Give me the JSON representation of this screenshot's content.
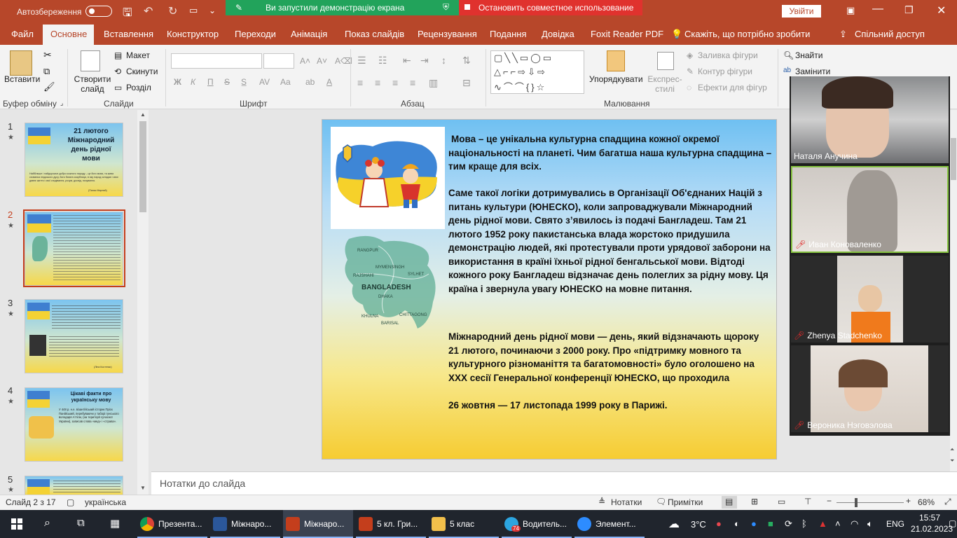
{
  "titlebar": {
    "autosave_label": "Автозбереження",
    "autosave_state": "off",
    "sharing_text": "Ви запустили демонстрацію екрана",
    "stop_sharing": "Остановить совместное использование",
    "signin": "Увійти",
    "accent": "#b7472a"
  },
  "tabs": [
    "Файл",
    "Основне",
    "Вставлення",
    "Конструктор",
    "Переходи",
    "Анімація",
    "Показ слайдів",
    "Рецензування",
    "Подання",
    "Довідка",
    "Foxit Reader PDF",
    "Скажіть, що потрібно зробити",
    "Спільний доступ"
  ],
  "ribbon": {
    "clipboard": {
      "paste": "Вставити",
      "label": "Буфер обміну"
    },
    "slides": {
      "new_slide": "Створити слайд",
      "layout": "Макет",
      "reset": "Скинути",
      "section": "Розділ",
      "label": "Слайди"
    },
    "font": {
      "label": "Шрифт",
      "bold": "Ж",
      "italic": "К",
      "underline": "П",
      "strike": "S"
    },
    "paragraph": {
      "label": "Абзац"
    },
    "drawing": {
      "label": "Малювання",
      "arrange": "Упорядкувати",
      "styles": "Експрес-стилі",
      "fill": "Заливка фігури",
      "outline": "Контур фігури",
      "effects": "Ефекти для фігур"
    },
    "editing": {
      "find": "Знайти",
      "replace": "Замінити"
    }
  },
  "thumbnails": [
    {
      "num": "1",
      "title": "21 лютого Міжнародний день рідної мови",
      "caption": "Найбільше і найдорожче добро кожного народу – це його мова, та жива схованка людського духу, його багата скарбниця, в яку народ складає і своє давнє життя і свої сподівання, розум, досвід, почування.",
      "author": "(Панас Мирний)"
    },
    {
      "num": "2"
    },
    {
      "num": "3",
      "author": "(Ліна Костенко)"
    },
    {
      "num": "4",
      "title": "Цікаві факти про українську мову",
      "caption": "У 448 р. н.е. візантійський історик Пріск Панійський, перебуваючи у таборі гунського володаря Аттіли, (на території сучасної України), записав слова «мед» і «страва»."
    },
    {
      "num": "5"
    }
  ],
  "slide": {
    "map_label": "BANGLADESH",
    "map_regions": [
      "RANGPUR",
      "MYMENSINGH",
      "SYLHET",
      "RAJSHAHI",
      "DHAKA",
      "KHULNA",
      "BARISAL",
      "CHITTAGONG"
    ],
    "p1": "Мова – це унікальна культурна спадщина кожної окремої національності на планеті. Чим багатша наша культурна спадщина – тим краще для всіх.",
    "p2": "Саме такої логіки дотримувались в Організації Об'єднаних Націй з питань культури (ЮНЕСКО), коли запроваджували Міжнародний день рідної мови. Свято з’явилось із подачі Бангладеш. Там 21 лютого 1952 року пакистанська влада жорстоко придушила демонстрацію людей, які протестували проти урядової заборони на використання в країні їхньої рідної бенгальської мови. Відтоді кожного року Бангладеш відзначає день полеглих за рідну мову. Ця країна і звернула увагу ЮНЕСКО на мовне питання.",
    "p3": "Міжнародний день рідної мови — день, який відзначають щороку 21 лютого, починаючи з 2000 року. Про «підтримку мовного та культурного різноманіття та багатомовності» було оголошено на XXX сесії Генеральної конференції ЮНЕСКО, що проходила",
    "p4": "26 жовтня — 17 листопада 1999 року в Парижі."
  },
  "notes_placeholder": "Нотатки до слайда",
  "video": [
    "Наталя Анучина",
    "Иван Коноваленко",
    "Zhenya Stadchenko",
    "Вероника Нэговэлова"
  ],
  "status": {
    "slide": "Слайд 2 з 17",
    "lang": "українська",
    "notes": "Нотатки",
    "comments": "Примітки",
    "zoom": "68%"
  },
  "taskbar": {
    "items": [
      "Презента...",
      "Міжнаро...",
      "Міжнаро...",
      "5 кл. Гри...",
      "5 клас",
      "Водитель...",
      "Элемент..."
    ],
    "telegram_badge": "74",
    "weather": "3°C",
    "lang": "ENG",
    "time": "15:57",
    "date": "21.02.2023"
  }
}
